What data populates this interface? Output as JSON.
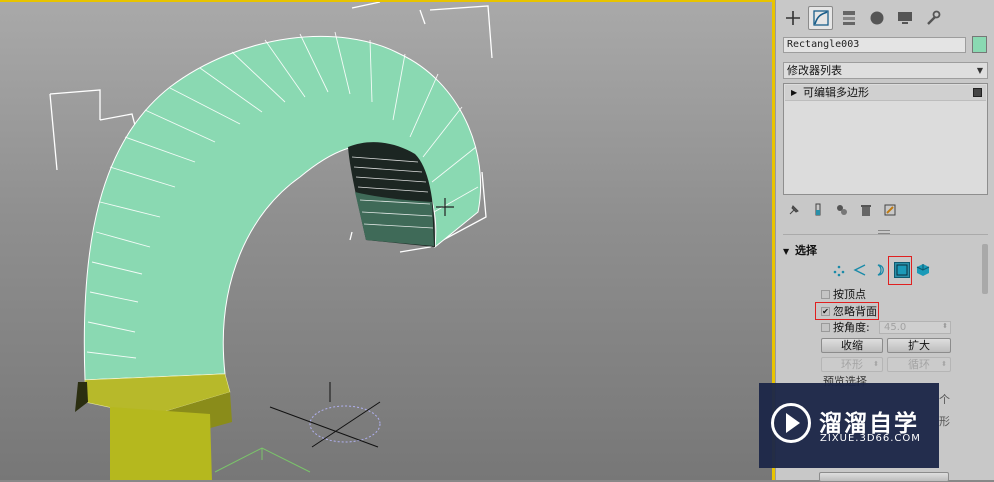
{
  "command_panel": {
    "tabs": [
      {
        "name": "create-tab",
        "icon": "plus-icon"
      },
      {
        "name": "modify-tab",
        "icon": "modify-curve-icon",
        "active": true
      },
      {
        "name": "hierarchy-tab",
        "icon": "hierarchy-icon"
      },
      {
        "name": "motion-tab",
        "icon": "motion-icon"
      },
      {
        "name": "display-tab",
        "icon": "monitor-icon"
      },
      {
        "name": "utilities-tab",
        "icon": "wrench-icon"
      }
    ],
    "object_name": "Rectangle003",
    "object_color": "#8ad9b2",
    "modifier_list_label": "修改器列表",
    "modifier_stack": [
      {
        "label": "可编辑多边形"
      }
    ]
  },
  "selection_rollout": {
    "title": "选择",
    "subobject_levels": [
      {
        "name": "vertex",
        "icon": "vertex-icon"
      },
      {
        "name": "edge",
        "icon": "edge-icon"
      },
      {
        "name": "border",
        "icon": "border-icon"
      },
      {
        "name": "polygon",
        "icon": "polygon-icon",
        "active": true
      },
      {
        "name": "element",
        "icon": "element-icon"
      }
    ],
    "by_vertex_label": "按顶点",
    "by_vertex_checked": false,
    "ignore_backfacing_label": "忽略背面",
    "ignore_backfacing_checked": true,
    "by_angle_label": "按角度:",
    "by_angle_checked": false,
    "by_angle_value": "45.0",
    "shrink_label": "收缩",
    "grow_label": "扩大",
    "ring_label": "环形",
    "loop_label": "循环",
    "preview_label": "预览选择",
    "partial_text_1": "个",
    "partial_text_2": "形"
  },
  "watermark": {
    "title": "溜溜自学",
    "subtitle": "ZIXUE.3D66.COM"
  },
  "colors": {
    "viewport_border": "#e8c400",
    "mesh_face": "#8ad9b2",
    "base_face": "#b7b92a",
    "highlight_box": "#e02020",
    "active_subobject": "#2a8fa8"
  }
}
